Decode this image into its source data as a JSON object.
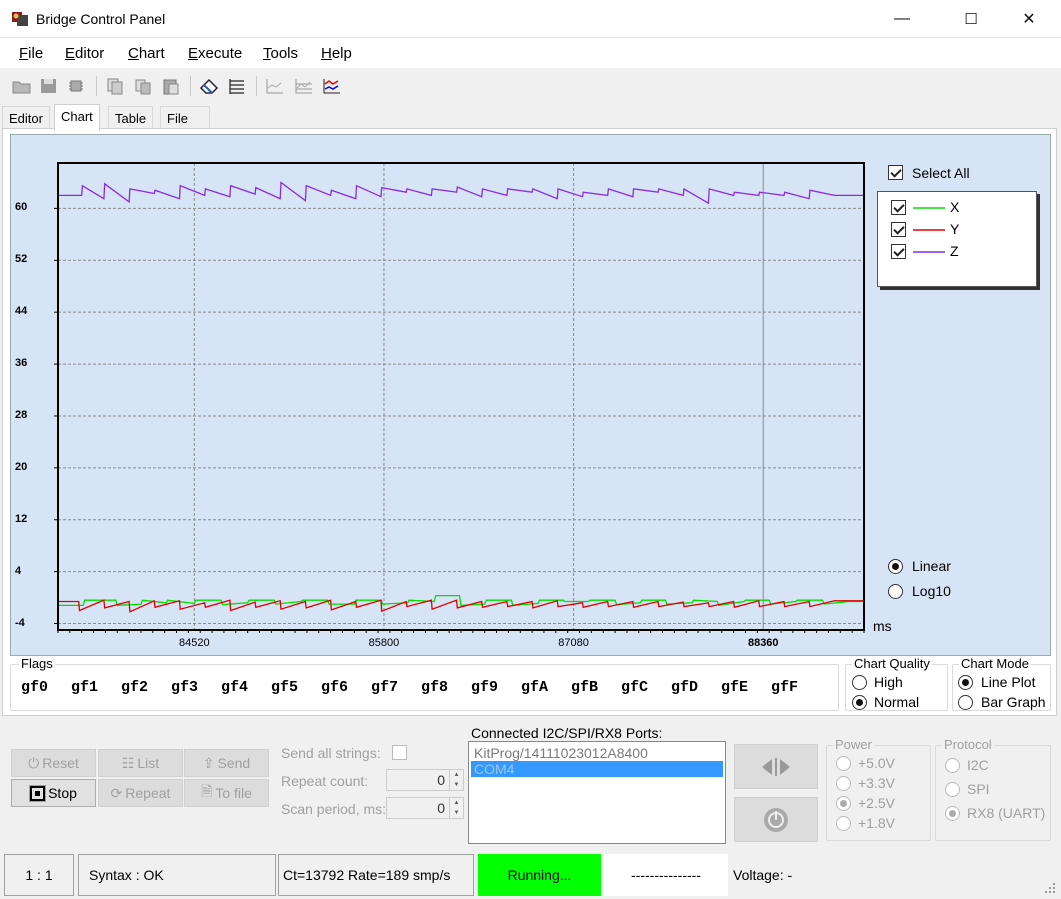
{
  "window": {
    "title": "Bridge Control Panel",
    "minimize": "—",
    "maximize": "☐",
    "close": "✕"
  },
  "menu": [
    {
      "key": "F",
      "rest": "ile"
    },
    {
      "key": "E",
      "rest": "ditor"
    },
    {
      "key": "C",
      "rest": "hart"
    },
    {
      "key": "E",
      "rest": "xecute"
    },
    {
      "key": "T",
      "rest": "ools"
    },
    {
      "key": "H",
      "rest": "elp"
    }
  ],
  "toolbar_icons": [
    "open-folder-icon",
    "save-icon",
    "settings-chip-icon",
    "copy-icon",
    "copy-alt-icon",
    "paste-icon",
    "eraser-icon",
    "list-icon",
    "chart-flat-icon",
    "chart-grid-icon",
    "chart-color-icon"
  ],
  "tabs": [
    {
      "label": "Editor",
      "active": false
    },
    {
      "label": "Chart",
      "active": true
    },
    {
      "label": "Table",
      "active": false
    },
    {
      "label": "File",
      "active": false
    }
  ],
  "chart": {
    "select_all_label": "Select All",
    "select_all_checked": true,
    "scale_linear_label": "Linear",
    "scale_log_label": "Log10",
    "scale_selected": "Linear",
    "x_unit": "ms"
  },
  "chart_data": {
    "type": "line",
    "xlabel": "ms",
    "ylabel": "",
    "ylim": [
      -5,
      67
    ],
    "xlim": [
      83600,
      89040
    ],
    "y_ticks": [
      "60",
      "52",
      "44",
      "36",
      "28",
      "20",
      "12",
      "4",
      "-4"
    ],
    "y_tick_values": [
      60,
      52,
      44,
      36,
      28,
      20,
      12,
      4,
      -4
    ],
    "x_ticks": [
      "84520",
      "85800",
      "87080",
      "88360"
    ],
    "x_tick_values": [
      84520,
      85800,
      87080,
      88360
    ],
    "grid": true,
    "legend_position": "right",
    "series": [
      {
        "name": "X",
        "color": "#00e000",
        "x": [
          83600,
          83770,
          83780,
          83990,
          84000,
          84160,
          84170,
          84330,
          84340,
          84520,
          84530,
          84700,
          84710,
          84880,
          84890,
          85060,
          85070,
          85240,
          85250,
          85420,
          85430,
          85600,
          85610,
          85780,
          85790,
          85960,
          85970,
          86140,
          86150,
          86310,
          86320,
          86480,
          86490,
          86660,
          86670,
          86840,
          86850,
          87010,
          87020,
          87180,
          87190,
          87360,
          87370,
          87530,
          87540,
          87700,
          87710,
          87880,
          87890,
          88050,
          88060,
          88230,
          88240,
          88400,
          88410,
          88580,
          88590,
          88760,
          88770,
          88940,
          89040
        ],
        "values": [
          -1.2,
          -1.2,
          -0.4,
          -0.4,
          -1.2,
          -1.0,
          -0.4,
          -0.8,
          -0.4,
          -0.9,
          -0.4,
          -0.4,
          -1.1,
          -0.8,
          -0.4,
          -0.4,
          -1.0,
          -0.6,
          -0.4,
          -0.4,
          -1.0,
          -1.0,
          -0.4,
          -0.4,
          -1.0,
          -0.8,
          -0.4,
          -0.6,
          0.3,
          0.3,
          -1.2,
          -1.0,
          -0.4,
          -0.4,
          -1.2,
          -0.9,
          -0.4,
          -0.4,
          -0.6,
          -0.6,
          -0.4,
          -0.4,
          -1.1,
          -0.8,
          -0.4,
          -0.4,
          -1.0,
          -0.8,
          -0.4,
          -0.6,
          -1.2,
          -0.6,
          -0.4,
          -0.4,
          -1.0,
          -0.6,
          -0.4,
          -0.4,
          -1.0,
          -0.6,
          -0.6
        ]
      },
      {
        "name": "Y",
        "color": "#e00000",
        "x": [
          83600,
          83740,
          83745,
          83910,
          83915,
          84080,
          84085,
          84250,
          84255,
          84420,
          84425,
          84590,
          84595,
          84760,
          84765,
          84930,
          84935,
          85100,
          85105,
          85270,
          85275,
          85440,
          85445,
          85610,
          85615,
          85780,
          85785,
          85950,
          85955,
          86120,
          86125,
          86290,
          86295,
          86460,
          86465,
          86630,
          86635,
          86800,
          86805,
          86970,
          86975,
          87140,
          87145,
          87310,
          87315,
          87480,
          87485,
          87650,
          87655,
          87820,
          87825,
          87990,
          87995,
          88160,
          88165,
          88330,
          88335,
          88500,
          88505,
          88670,
          88675,
          88840,
          88845,
          89040
        ],
        "values": [
          -0.6,
          -0.6,
          -2.0,
          -0.4,
          -1.6,
          -0.6,
          -2.2,
          -0.5,
          -1.5,
          -0.5,
          -1.8,
          -0.8,
          -1.5,
          -0.4,
          -2.0,
          -0.7,
          -1.5,
          -0.5,
          -1.8,
          -0.6,
          -1.6,
          -0.4,
          -1.9,
          -0.6,
          -1.5,
          -0.4,
          -2.1,
          -0.6,
          -1.4,
          -0.4,
          -1.8,
          -0.4,
          -1.6,
          -0.6,
          -1.5,
          -0.6,
          -1.4,
          -0.6,
          -1.6,
          -0.5,
          -1.4,
          -0.8,
          -1.5,
          -0.6,
          -1.4,
          -0.6,
          -1.5,
          -0.6,
          -1.4,
          -0.7,
          -1.4,
          -0.8,
          -1.4,
          -0.6,
          -1.5,
          -0.5,
          -1.4,
          -0.6,
          -1.4,
          -0.6,
          -1.4,
          -0.5,
          -0.5,
          -0.5
        ]
      },
      {
        "name": "Z",
        "color": "#8a2be2",
        "x": [
          83600,
          83760,
          83765,
          83910,
          83915,
          84080,
          84085,
          84250,
          84255,
          84420,
          84425,
          84590,
          84595,
          84760,
          84765,
          84930,
          84935,
          85100,
          85105,
          85270,
          85275,
          85440,
          85445,
          85610,
          85615,
          85780,
          85785,
          85950,
          85955,
          86120,
          86125,
          86290,
          86295,
          86460,
          86465,
          86630,
          86635,
          86800,
          86805,
          86970,
          86975,
          87140,
          87145,
          87310,
          87315,
          87480,
          87485,
          87650,
          87655,
          87820,
          87825,
          87990,
          87995,
          88160,
          88165,
          88330,
          88335,
          88500,
          88505,
          88670,
          88675,
          88840,
          88845,
          89040
        ],
        "values": [
          62.0,
          62.0,
          63.5,
          61.5,
          63.8,
          61.0,
          63.0,
          62.3,
          62.8,
          61.5,
          63.5,
          62.0,
          63.0,
          61.8,
          63.5,
          62.2,
          63.2,
          61.5,
          64.0,
          61.2,
          63.5,
          62.0,
          62.8,
          61.5,
          63.5,
          61.8,
          63.2,
          62.5,
          63.0,
          62.0,
          63.0,
          62.5,
          63.3,
          61.8,
          63.0,
          62.0,
          63.0,
          62.5,
          63.0,
          61.5,
          63.0,
          61.8,
          62.5,
          62.0,
          63.0,
          61.8,
          63.0,
          62.5,
          63.0,
          62.0,
          63.0,
          60.8,
          63.0,
          62.0,
          62.5,
          62.0,
          62.5,
          62.0,
          62.5,
          61.5,
          62.8,
          62.0,
          62.0,
          62.0
        ]
      }
    ]
  },
  "flags": {
    "title": "Flags",
    "items": [
      "gf0",
      "gf1",
      "gf2",
      "gf3",
      "gf4",
      "gf5",
      "gf6",
      "gf7",
      "gf8",
      "gf9",
      "gfA",
      "gfB",
      "gfC",
      "gfD",
      "gfE",
      "gfF"
    ]
  },
  "chart_quality": {
    "title": "Chart Quality",
    "high": "High",
    "normal": "Normal",
    "selected": "Normal"
  },
  "chart_mode": {
    "title": "Chart Mode",
    "line": "Line Plot",
    "bar": "Bar Graph",
    "selected": "Line Plot"
  },
  "controls": {
    "reset": "Reset",
    "list": "List",
    "send": "Send",
    "stop": "Stop",
    "repeat": "Repeat",
    "to_file": "To file",
    "send_all_strings": "Send all strings:",
    "repeat_count_label": "Repeat count:",
    "repeat_count_value": "0",
    "scan_period_label": "Scan period, ms:",
    "scan_period_value": "0"
  },
  "ports": {
    "title": "Connected I2C/SPI/RX8 Ports:",
    "items": [
      "KitProg/14111023012A8400",
      "COM4"
    ],
    "selected_index": 1
  },
  "power": {
    "title": "Power",
    "options": [
      "+5.0V",
      "+3.3V",
      "+2.5V",
      "+1.8V"
    ],
    "selected": "+2.5V"
  },
  "protocol": {
    "title": "Protocol",
    "options": [
      "I2C",
      "SPI",
      "RX8 (UART)"
    ],
    "selected": "RX8 (UART)"
  },
  "status": {
    "position": "1 : 1",
    "syntax": "Syntax : OK",
    "counters": "Ct=13792 Rate=189 smp/s",
    "running": "Running...",
    "dashes": "---------------",
    "voltage": "Voltage: -",
    "running_color": "#00ff00"
  }
}
